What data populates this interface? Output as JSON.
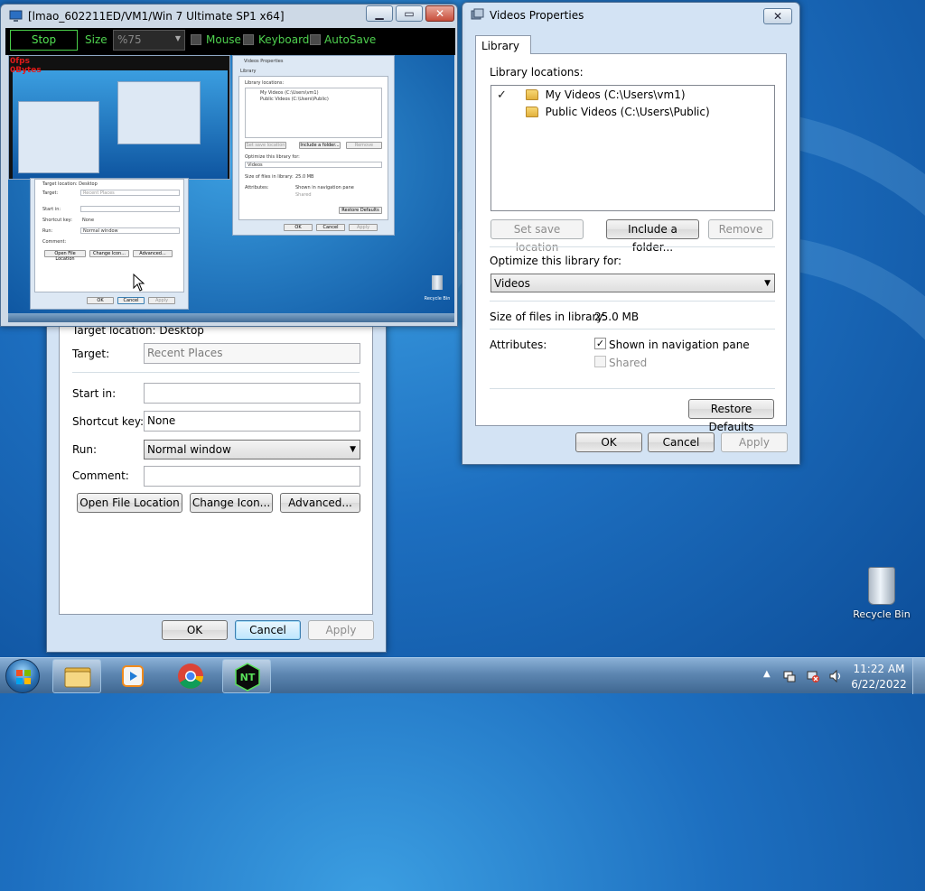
{
  "viewer": {
    "title": "[lmao_602211ED/VM1/Win 7 Ultimate SP1 x64]",
    "stop_label": "Stop",
    "size_label": "Size",
    "size_value": "%75",
    "mouse_label": "Mouse",
    "keyboard_label": "Keyboard",
    "autosave_label": "AutoSave",
    "remote": {
      "mini_title": "Videos Properties",
      "mini_tab": "Library",
      "mini_locations_label": "Library locations:",
      "mini_loc1": "My Videos (C:\\Users\\vm1)",
      "mini_loc2": "Public Videos (C:\\Users\\Public)",
      "mini_set_save": "Set save location",
      "mini_include": "Include a folder...",
      "mini_remove": "Remove",
      "mini_optimize": "Optimize this library for:",
      "mini_videos": "Videos",
      "mini_size": "Size of files in library:",
      "mini_size_value": "25.0 MB",
      "mini_attributes": "Attributes:",
      "mini_shown": "Shown in navigation pane",
      "mini_shared": "Shared",
      "mini_restore": "Restore Defaults",
      "mini_ok": "OK",
      "mini_cancel": "Cancel",
      "mini_apply": "Apply",
      "mini_target_location": "Target location: Desktop",
      "mini_target": "Target:",
      "mini_target_value": "Recent Places",
      "mini_start_in": "Start in:",
      "mini_shortcut": "Shortcut key:",
      "mini_none": "None",
      "mini_run": "Run:",
      "mini_normal": "Normal window",
      "mini_comment": "Comment:",
      "mini_open_file": "Open File Location",
      "mini_change_icon": "Change Icon...",
      "mini_advanced": "Advanced...",
      "mini_recycle": "Recycle Bin",
      "mini_fps": "0fps",
      "mini_bytes": "0Bytes"
    }
  },
  "shortcut": {
    "target_location": "Target location:  Desktop",
    "target_label": "Target:",
    "target_value": "Recent Places",
    "start_in_label": "Start in:",
    "start_in_value": "",
    "shortcut_key_label": "Shortcut key:",
    "shortcut_key_value": "None",
    "run_label": "Run:",
    "run_value": "Normal window",
    "comment_label": "Comment:",
    "comment_value": "",
    "open_file_location": "Open File Location",
    "change_icon": "Change Icon...",
    "advanced": "Advanced...",
    "ok": "OK",
    "cancel": "Cancel",
    "apply": "Apply"
  },
  "videos_properties": {
    "title": "Videos Properties",
    "tab_library": "Library",
    "library_locations_label": "Library locations:",
    "locations": [
      {
        "label": "My Videos (C:\\Users\\vm1)",
        "is_default": true
      },
      {
        "label": "Public Videos (C:\\Users\\Public)",
        "is_default": false
      }
    ],
    "set_save_location": "Set save location",
    "include_folder": "Include a folder...",
    "remove": "Remove",
    "optimize_label": "Optimize this library for:",
    "optimize_value": "Videos",
    "size_label": "Size of files in library:",
    "size_value": "25.0 MB",
    "attributes_label": "Attributes:",
    "shown_in_nav": "Shown in navigation pane",
    "shown_in_nav_checked": true,
    "shared": "Shared",
    "shared_checked": false,
    "restore_defaults": "Restore Defaults",
    "ok": "OK",
    "cancel": "Cancel",
    "apply": "Apply"
  },
  "desktop": {
    "recycle_bin": "Recycle Bin"
  },
  "taskbar": {
    "time": "11:22 AM",
    "date": "6/22/2022",
    "pinned": [
      "file-explorer-icon",
      "media-player-icon",
      "chrome-icon",
      "nt-app-icon"
    ]
  },
  "colors": {
    "toolbar_green": "#4fd14f",
    "desktop_blue": "#1d6fc0"
  }
}
